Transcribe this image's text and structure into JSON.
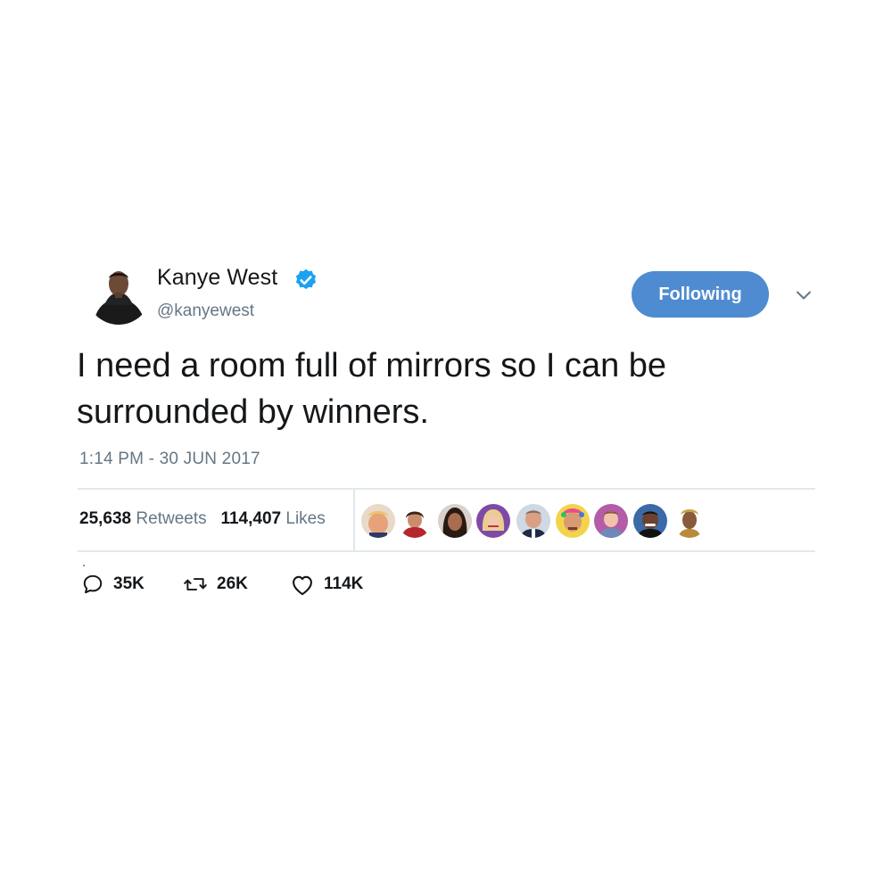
{
  "user": {
    "display_name": "Kanye West",
    "handle": "@kanyewest",
    "verified": true
  },
  "follow_button": {
    "label": "Following"
  },
  "tweet": {
    "text": "I need a room full of mirrors so I can be surrounded by winners.",
    "timestamp": "1:14 PM - 30 JUN 2017"
  },
  "stats": {
    "retweets_count": "25,638",
    "retweets_label": "Retweets",
    "likes_count": "114,407",
    "likes_label": "Likes"
  },
  "actions": {
    "replies": "35K",
    "retweets": "26K",
    "likes": "114K"
  },
  "colors": {
    "accent": "#4f8bd0",
    "verified": "#1da1f2",
    "muted_text": "#657786",
    "divider": "#e1e8ed"
  },
  "liker_avatars": [
    {
      "icon": "avatar-1"
    },
    {
      "icon": "avatar-2"
    },
    {
      "icon": "avatar-3"
    },
    {
      "icon": "avatar-4"
    },
    {
      "icon": "avatar-5"
    },
    {
      "icon": "avatar-6"
    },
    {
      "icon": "avatar-7"
    },
    {
      "icon": "avatar-8"
    },
    {
      "icon": "avatar-9"
    }
  ]
}
